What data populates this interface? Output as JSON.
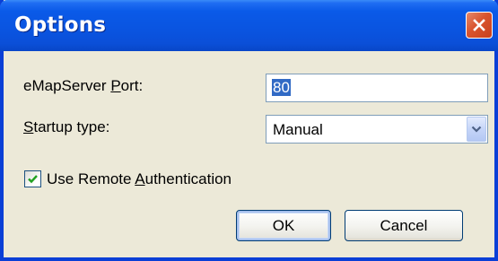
{
  "window": {
    "title": "Options"
  },
  "form": {
    "port_label_pre": "eMapServer ",
    "port_label_key": "P",
    "port_label_post": "ort:",
    "port_value": "80",
    "startup_label_key": "S",
    "startup_label_post": "tartup type:",
    "startup_value": "Manual",
    "remote_auth_pre": "Use Remote ",
    "remote_auth_key": "A",
    "remote_auth_post": "uthentication",
    "remote_auth_checked": true
  },
  "buttons": {
    "ok": "OK",
    "cancel": "Cancel"
  },
  "colors": {
    "titlebar": "#0a54e0",
    "dialog_bg": "#ece9d8",
    "close": "#d9542e",
    "check": "#21a121"
  },
  "icons": {
    "close": "close-icon",
    "dropdown": "chevron-down-icon",
    "check": "checkmark-icon"
  }
}
